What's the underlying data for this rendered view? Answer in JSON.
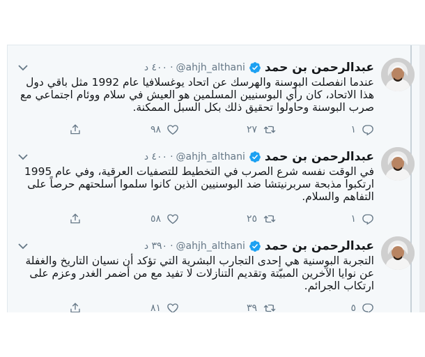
{
  "tweets": [
    {
      "name": "عبدالرحمن بن حمد",
      "handle": "@ahjh_althani",
      "separator": "·",
      "time": "٤٠٠ د",
      "body": "عندما انفصلت البوسنة والهرسك عن اتحاد يوغسلافيا عام 1992 مثل باقي دول هذا الاتحاد، كان رأي البوسنيين المسلمين هو العيش في سلام ووئام اجتماعي مع صرب البوسنة وحاولوا تحقيق ذلك بكل السبل الممكنة.",
      "reply_count": "١",
      "retweet_count": "٢٧",
      "like_count": "٩٨"
    },
    {
      "name": "عبدالرحمن بن حمد",
      "handle": "@ahjh_althani",
      "separator": "·",
      "time": "٤٠٠ د",
      "body": "في الوقت نفسه شرع الصرب في التخطيط للتصفيات العرقية، وفي عام 1995 ارتكبوا مذبحة سربرنيتشا ضد البوسنيين الذين كانوا سلموا أسلحتهم حرصاً على التفاهم والسلام.",
      "reply_count": "١",
      "retweet_count": "٢٥",
      "like_count": "٥٨"
    },
    {
      "name": "عبدالرحمن بن حمد",
      "handle": "@ahjh_althani",
      "separator": "·",
      "time": "٣٩٠ د",
      "body": "التجربة البوسنية هي إحدى التجارب البشرية التي تؤكد أن نسيان التاريخ والغفلة عن نوايا الآخرين المبيّتة وتقديم التنازلات لا تفيد مع من أضمر الغدر وعزم على ارتكاب الجرائم.",
      "reply_count": "٥",
      "retweet_count": "٣٩",
      "like_count": "٨١"
    }
  ],
  "icons": {
    "more": "chevron-down-icon",
    "verified": "verified-badge-icon",
    "reply": "reply-icon",
    "retweet": "retweet-icon",
    "like": "heart-icon",
    "share": "share-icon"
  },
  "colors": {
    "verified_blue": "#1da1f2",
    "text": "#14171a",
    "secondary": "#657786",
    "card_bg": "#f5f8fa"
  }
}
